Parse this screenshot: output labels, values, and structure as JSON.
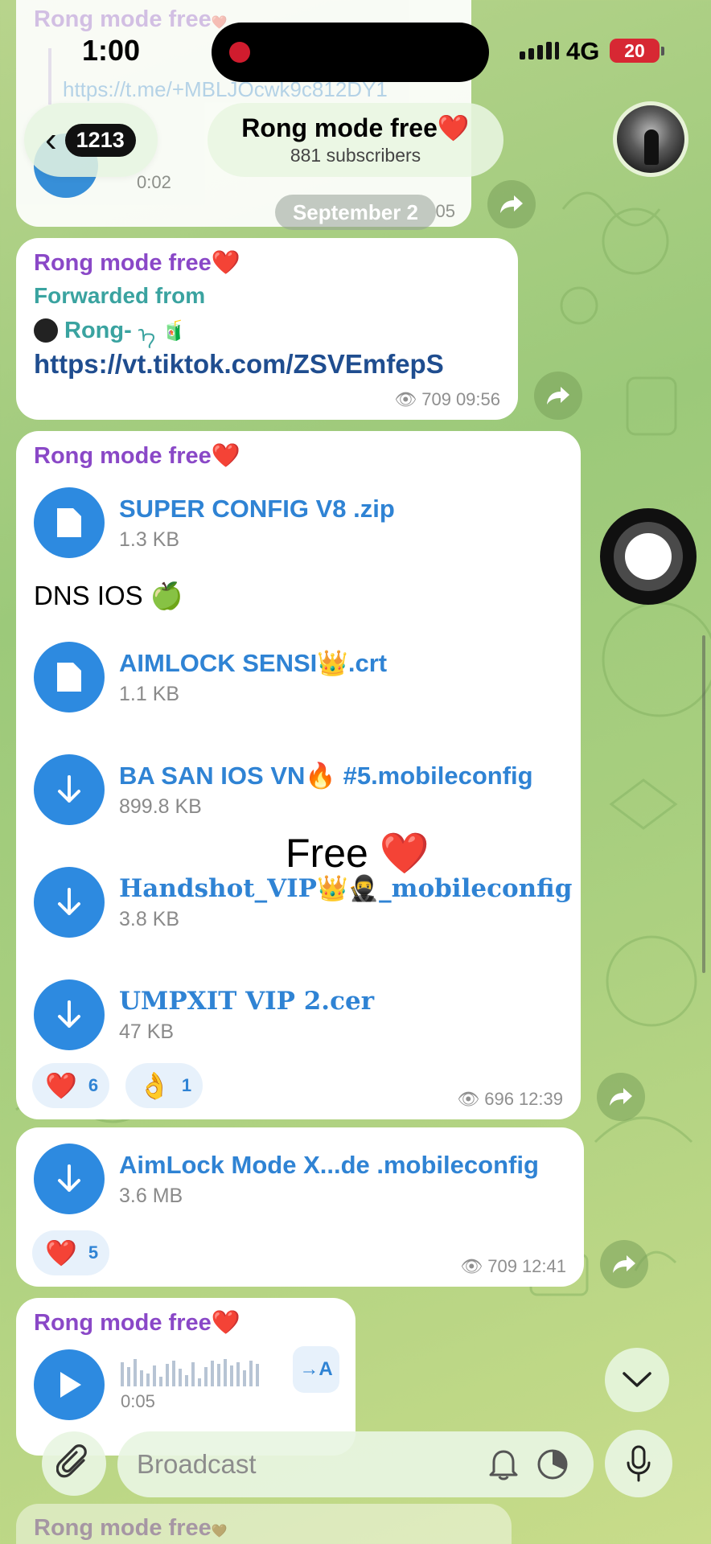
{
  "status_bar": {
    "time": "1:00",
    "network": "4G",
    "battery": "20"
  },
  "header": {
    "back_count": "1213",
    "title": "Rong mode free",
    "title_emoji": "❤️",
    "subtitle": "881 subscribers"
  },
  "top_partial": {
    "sender": "Rong mode free",
    "sender_emoji": "❤️",
    "link": "https://t.me/+MBLJOcwk9c812DY1",
    "duration": "0:02",
    "time_partial": "05"
  },
  "date_separator": "September 2",
  "post_link": {
    "sender": "Rong mode free",
    "forwarded_label": "Forwarded from",
    "forward_source": "Rong-",
    "forward_source_suffix": "ᡝ",
    "url": "https://vt.tiktok.com/ZSVEmfepS",
    "views": "709",
    "time": "09:56"
  },
  "post_files": {
    "sender": "Rong mode free",
    "files_top": [
      {
        "name": "SUPER CONFIG V8 .zip",
        "size": "1.3 KB",
        "icon": "document-icon"
      }
    ],
    "caption": "DNS IOS",
    "caption_emoji": "🍏",
    "files": [
      {
        "name": "AIMLOCK SENSI👑.crt",
        "size": "1.1 KB",
        "icon": "document-icon"
      },
      {
        "name": "BA SAN IOS VN🔥 #5.mobileconfig",
        "size": "899.8 KB",
        "icon": "download-icon"
      },
      {
        "name": "Handshot_VIP👑🥷_mobileconfig",
        "size": "3.8 KB",
        "icon": "download-icon"
      },
      {
        "name": "UMPXIT VIP 2.cer",
        "size": "47 KB",
        "icon": "download-icon"
      }
    ],
    "reactions": [
      {
        "emoji": "❤️",
        "count": "6"
      },
      {
        "emoji": "👌",
        "count": "1"
      }
    ],
    "views": "696",
    "time": "12:39"
  },
  "overlay": {
    "text": "Free",
    "emoji": "❤️"
  },
  "post_aimlock": {
    "file": {
      "name": "AimLock Mode X...de .mobileconfig",
      "size": "3.6 MB",
      "icon": "download-icon"
    },
    "reactions": [
      {
        "emoji": "❤️",
        "count": "5"
      }
    ],
    "views": "709",
    "time": "12:41"
  },
  "post_voice": {
    "sender": "Rong mode free",
    "duration": "0:05",
    "transcribe_label": "→A"
  },
  "bottom_partial": {
    "sender": "Rong mode free",
    "emoji": "🤎"
  },
  "input": {
    "placeholder": "Broadcast"
  },
  "colors": {
    "accent": "#2d8ae0",
    "sender": "#8a48c7",
    "heart": "#e0212d"
  }
}
